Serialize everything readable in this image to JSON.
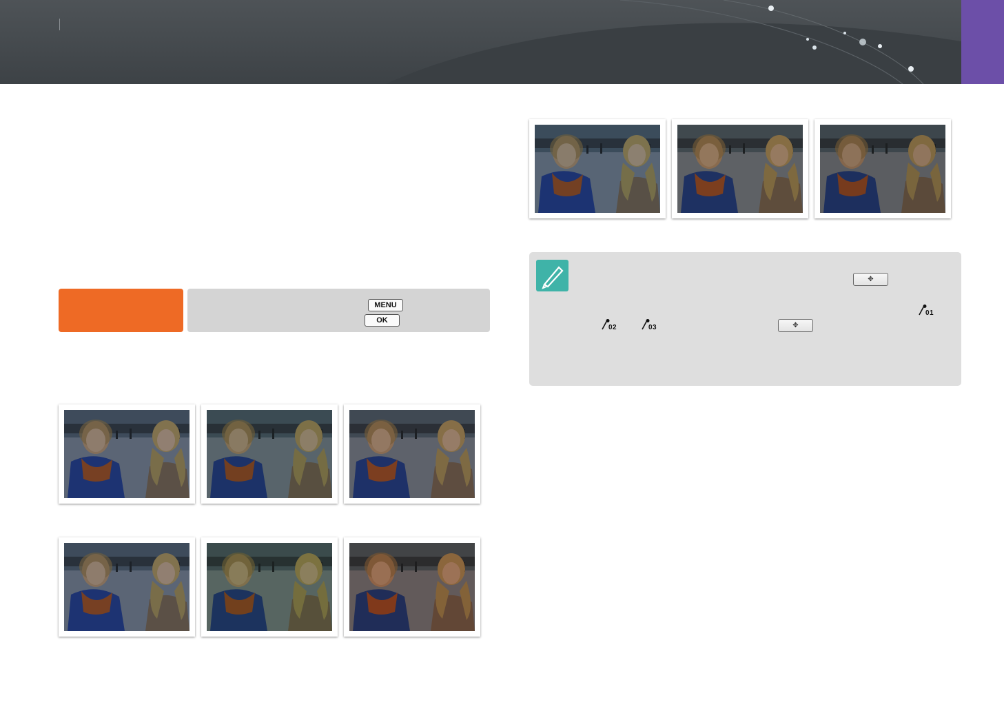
{
  "header": {
    "breadcrumb": ""
  },
  "mode_box": {
    "label": ""
  },
  "keys": {
    "menu": "MENU",
    "ok": "OK",
    "dial": "✥"
  },
  "note": {
    "brush_labels": [
      "01",
      "02",
      "03"
    ]
  },
  "photos": {
    "tints": {
      "row1": [
        "#3d5a8a",
        "#2f5560",
        "#4a5060"
      ],
      "row2": [
        "#3d5a8a",
        "#2e5a3a",
        "#5a3020"
      ],
      "row3": [
        "#2f5c86",
        "#4a4a48",
        "#3a3a3a"
      ]
    }
  },
  "colors": {
    "header": "#43484c",
    "tab": "#6c4fa8",
    "mode_label": "#ee6a25",
    "mode_panel": "#d4d4d4",
    "note_bg": "#dedede",
    "note_icon": "#3fb3a8"
  },
  "icons": {
    "note": "pen-nib-icon",
    "brush": "brush-icon",
    "dial": "dial-arrows-icon"
  }
}
